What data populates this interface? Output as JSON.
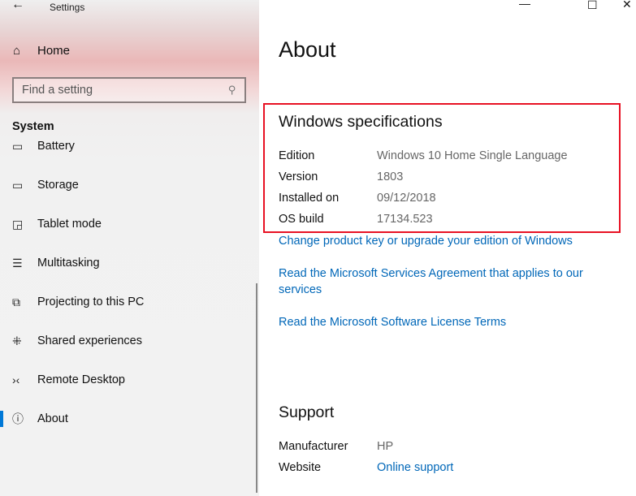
{
  "titlebar": {
    "title": "Settings",
    "back_icon": "arrow-left-icon"
  },
  "sidebar": {
    "home_label": "Home",
    "search_placeholder": "Find a setting",
    "section": "System",
    "items": [
      {
        "label": "Battery",
        "icon": "battery-icon"
      },
      {
        "label": "Storage",
        "icon": "storage-icon"
      },
      {
        "label": "Tablet mode",
        "icon": "tablet-mode-icon"
      },
      {
        "label": "Multitasking",
        "icon": "multitasking-icon"
      },
      {
        "label": "Projecting to this PC",
        "icon": "projecting-icon"
      },
      {
        "label": "Shared experiences",
        "icon": "shared-experiences-icon"
      },
      {
        "label": "Remote Desktop",
        "icon": "remote-desktop-icon"
      },
      {
        "label": "About",
        "icon": "info-icon",
        "active": true
      }
    ]
  },
  "main": {
    "title": "About",
    "specs": {
      "heading": "Windows specifications",
      "rows": [
        {
          "key": "Edition",
          "value": "Windows 10 Home Single Language"
        },
        {
          "key": "Version",
          "value": "1803"
        },
        {
          "key": "Installed on",
          "value": "09/12/2018"
        },
        {
          "key": "OS build",
          "value": "17134.523"
        }
      ]
    },
    "links": [
      "Change product key or upgrade your edition of Windows",
      "Read the Microsoft Services Agreement that applies to our services",
      "Read the Microsoft Software License Terms"
    ],
    "support": {
      "heading": "Support",
      "rows": [
        {
          "key": "Manufacturer",
          "value": "HP"
        },
        {
          "key": "Website",
          "value": "Online support"
        }
      ]
    }
  },
  "colors": {
    "accent": "#0078d7",
    "link": "#0067b8",
    "highlight_box": "#e81123"
  }
}
